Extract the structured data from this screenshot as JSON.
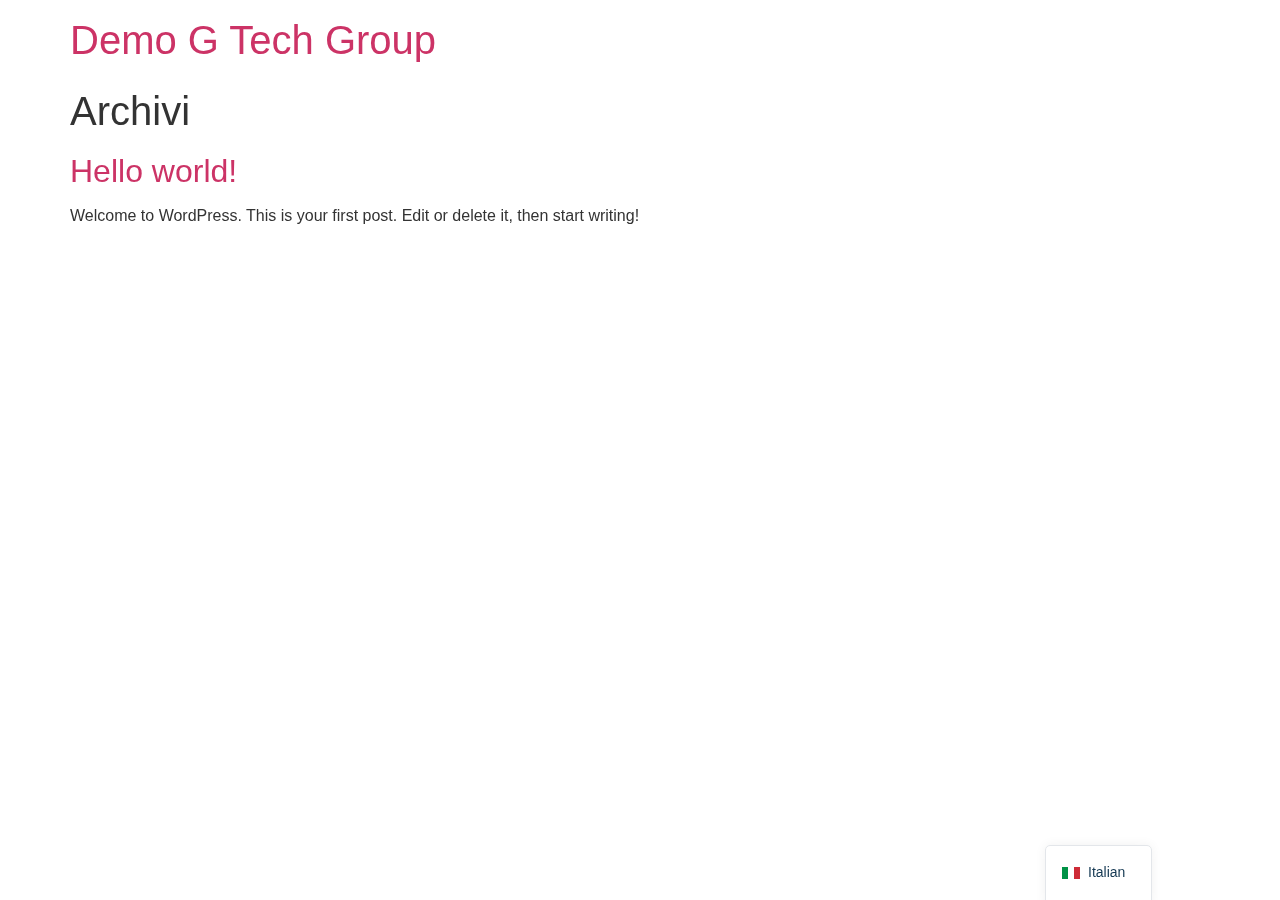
{
  "site_title": "Demo G Tech Group",
  "page_title": "Archivi",
  "posts": [
    {
      "title": "Hello world!",
      "excerpt": "Welcome to WordPress. This is your first post. Edit or delete it, then start writing!"
    }
  ],
  "language_switcher": {
    "language": "Italian"
  }
}
